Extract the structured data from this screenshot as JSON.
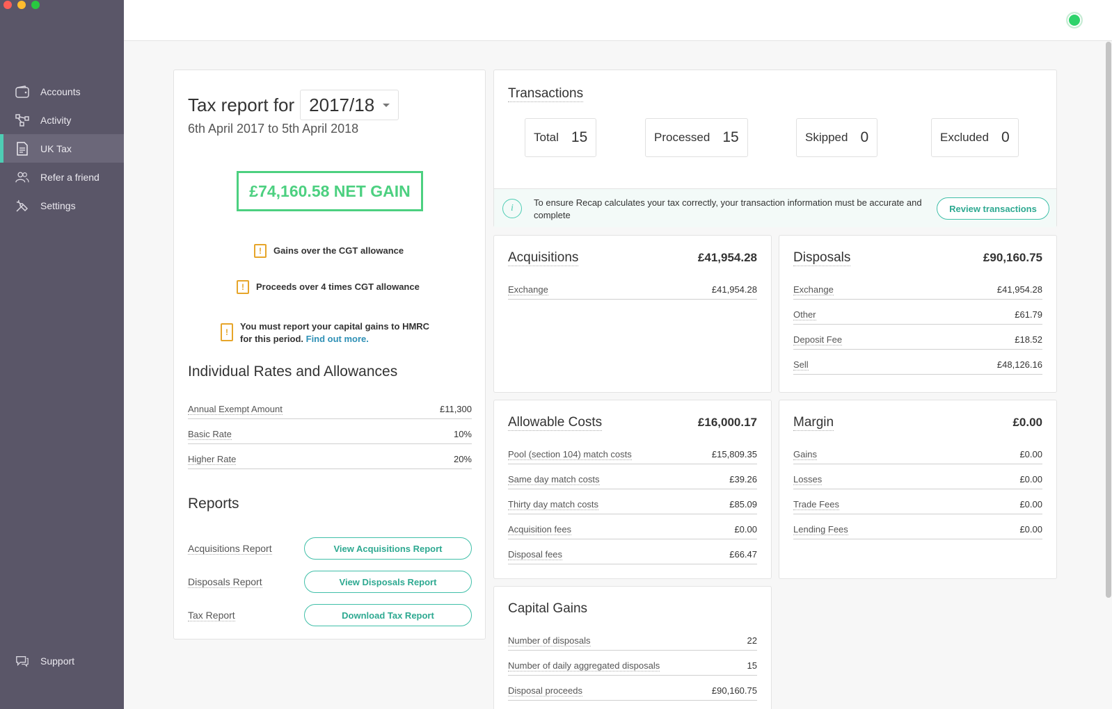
{
  "sidebar": {
    "items": [
      {
        "label": "Accounts",
        "icon": "wallet-icon"
      },
      {
        "label": "Activity",
        "icon": "activity-icon"
      },
      {
        "label": "UK Tax",
        "icon": "document-icon"
      },
      {
        "label": "Refer a friend",
        "icon": "users-icon"
      },
      {
        "label": "Settings",
        "icon": "settings-icon"
      }
    ],
    "support_label": "Support"
  },
  "tax": {
    "title_prefix": "Tax report for",
    "year": "2017/18",
    "date_range": "6th April 2017 to 5th April 2018",
    "net_gain": "£74,160.58 NET GAIN",
    "warnings": [
      "Gains over the CGT allowance",
      "Proceeds over 4 times CGT allowance"
    ],
    "hmrc_line1": "You must report your capital gains to HMRC",
    "hmrc_line2": "for this period.",
    "hmrc_link": "Find out more."
  },
  "rates": {
    "title": "Individual Rates and Allowances",
    "rows": [
      {
        "label": "Annual Exempt Amount",
        "value": "£11,300"
      },
      {
        "label": "Basic Rate",
        "value": "10%"
      },
      {
        "label": "Higher Rate",
        "value": "20%"
      }
    ]
  },
  "reports": {
    "title": "Reports",
    "rows": [
      {
        "label": "Acquisitions Report",
        "button": "View Acquisitions Report"
      },
      {
        "label": "Disposals Report",
        "button": "View Disposals Report"
      },
      {
        "label": "Tax Report",
        "button": "Download Tax Report"
      }
    ]
  },
  "transactions": {
    "title": "Transactions",
    "stats": [
      {
        "label": "Total",
        "value": "15"
      },
      {
        "label": "Processed",
        "value": "15"
      },
      {
        "label": "Skipped",
        "value": "0"
      },
      {
        "label": "Excluded",
        "value": "0"
      }
    ],
    "banner": "To ensure Recap calculates your tax correctly, your transaction information must be accurate and complete",
    "review_button": "Review transactions"
  },
  "acquisitions": {
    "title": "Acquisitions",
    "total": "£41,954.28",
    "rows": [
      {
        "label": "Exchange",
        "value": "£41,954.28"
      }
    ]
  },
  "disposals": {
    "title": "Disposals",
    "total": "£90,160.75",
    "rows": [
      {
        "label": "Exchange",
        "value": "£41,954.28"
      },
      {
        "label": "Other",
        "value": "£61.79"
      },
      {
        "label": "Deposit Fee",
        "value": "£18.52"
      },
      {
        "label": "Sell",
        "value": "£48,126.16"
      }
    ]
  },
  "allowable": {
    "title": "Allowable Costs",
    "total": "£16,000.17",
    "rows": [
      {
        "label": "Pool (section 104) match costs",
        "value": "£15,809.35"
      },
      {
        "label": "Same day match costs",
        "value": "£39.26"
      },
      {
        "label": "Thirty day match costs",
        "value": "£85.09"
      },
      {
        "label": "Acquisition fees",
        "value": "£0.00"
      },
      {
        "label": "Disposal fees",
        "value": "£66.47"
      }
    ]
  },
  "margin": {
    "title": "Margin",
    "total": "£0.00",
    "rows": [
      {
        "label": "Gains",
        "value": "£0.00"
      },
      {
        "label": "Losses",
        "value": "£0.00"
      },
      {
        "label": "Trade Fees",
        "value": "£0.00"
      },
      {
        "label": "Lending Fees",
        "value": "£0.00"
      }
    ]
  },
  "capital_gains": {
    "title": "Capital Gains",
    "rows": [
      {
        "label": "Number of disposals",
        "value": "22"
      },
      {
        "label": "Number of daily aggregated disposals",
        "value": "15"
      },
      {
        "label": "Disposal proceeds",
        "value": "£90,160.75"
      }
    ]
  },
  "colors": {
    "sidebar_bg": "#5a5668",
    "accent": "#4ecdb4",
    "gain_green": "#4cd080",
    "warning": "#e6a52a",
    "link": "#2d8fb5"
  }
}
